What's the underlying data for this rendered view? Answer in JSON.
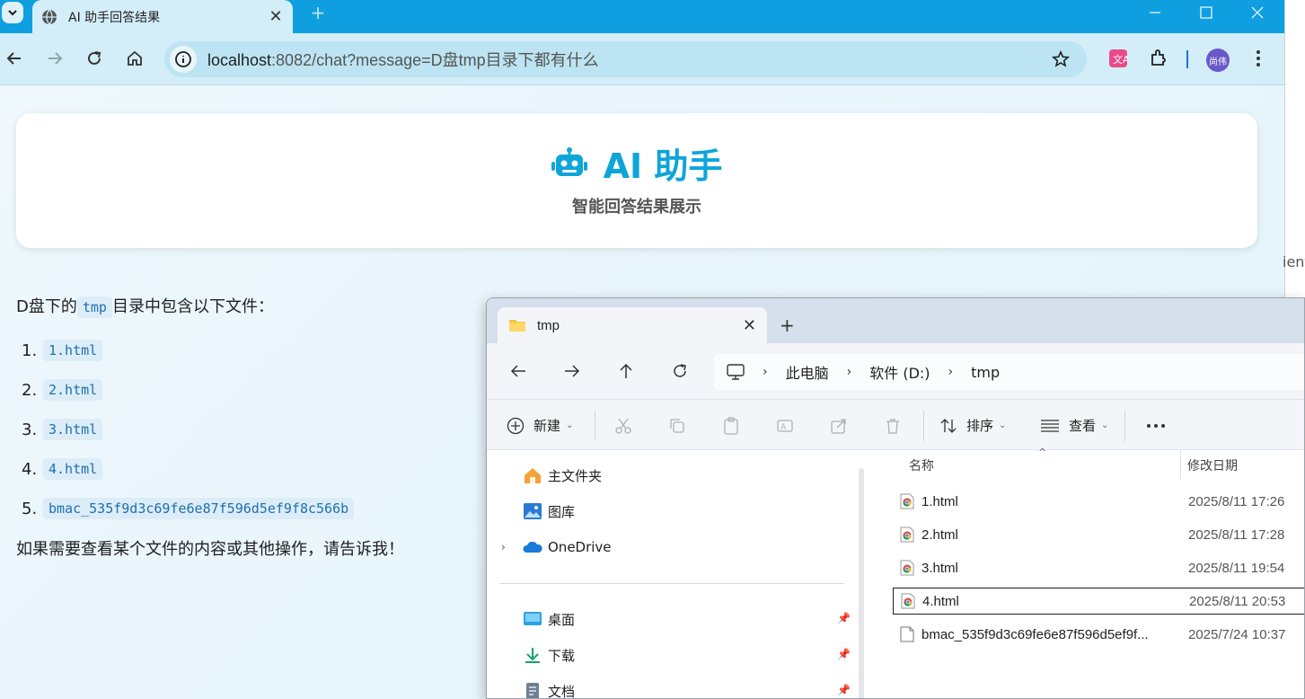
{
  "browser": {
    "tab_title": "AI 助手回答结果",
    "url_host": "localhost",
    "url_rest": ":8082/chat?message=D盘tmp目录下都有什么",
    "profile_label": "尚伟",
    "right_edge_text": "ient"
  },
  "page": {
    "title": "AI 助手",
    "subtitle": "智能回答结果展示",
    "intro_prefix": "D盘下的",
    "intro_code": "tmp",
    "intro_suffix": "目录中包含以下文件：",
    "files": [
      {
        "num": "1.",
        "name": "1.html"
      },
      {
        "num": "2.",
        "name": "2.html"
      },
      {
        "num": "3.",
        "name": "3.html"
      },
      {
        "num": "4.",
        "name": "4.html"
      },
      {
        "num": "5.",
        "name": "bmac_535f9d3c69fe6e87f596d5ef9f8c566b"
      }
    ],
    "closing": "如果需要查看某个文件的内容或其他操作，请告诉我！"
  },
  "explorer": {
    "tab_title": "tmp",
    "breadcrumb": [
      "此电脑",
      "软件 (D:)",
      "tmp"
    ],
    "commands": {
      "new": "新建",
      "sort": "排序",
      "view": "查看"
    },
    "nav_items": [
      {
        "label": "主文件夹",
        "icon": "home-icon"
      },
      {
        "label": "图库",
        "icon": "gallery-icon"
      },
      {
        "label": "OneDrive",
        "icon": "onedrive-icon"
      },
      {
        "label": "桌面",
        "icon": "desktop-icon"
      },
      {
        "label": "下载",
        "icon": "download-icon"
      },
      {
        "label": "文档",
        "icon": "documents-icon"
      }
    ],
    "columns": {
      "name": "名称",
      "modified": "修改日期"
    },
    "files": [
      {
        "name": "1.html",
        "date": "2025/8/11 17:26",
        "icon": "chrome-html-icon"
      },
      {
        "name": "2.html",
        "date": "2025/8/11 17:28",
        "icon": "chrome-html-icon"
      },
      {
        "name": "3.html",
        "date": "2025/8/11 19:54",
        "icon": "chrome-html-icon"
      },
      {
        "name": "4.html",
        "date": "2025/8/11 20:53",
        "icon": "chrome-html-icon"
      },
      {
        "name": "bmac_535f9d3c69fe6e87f596d5ef9f...",
        "date": "2025/7/24 10:37",
        "icon": "file-icon"
      }
    ]
  },
  "colors": {
    "chrome_blue": "#0f9fe0",
    "accent": "#0ea5d8",
    "code_text": "#1f6fb2"
  }
}
